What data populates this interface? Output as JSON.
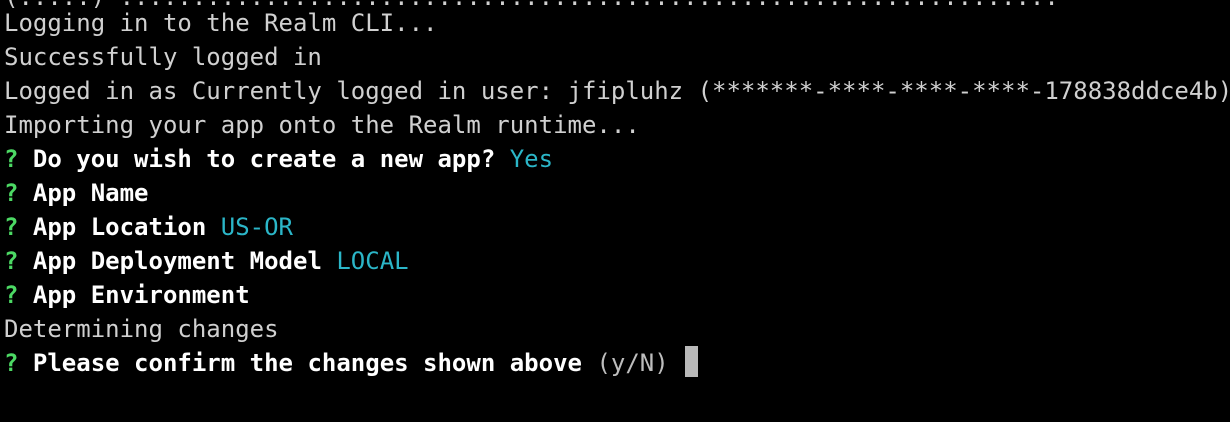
{
  "terminal": {
    "clipped_top_line": "(.....) .................................................................",
    "lines": [
      {
        "text": "Logging in to the Realm CLI..."
      },
      {
        "text": "Successfully logged in"
      },
      {
        "text": "Logged in as Currently logged in user: jfipluhz (*******-****-****-****-178838ddce4b)"
      },
      {
        "text": "Importing your app onto the Realm runtime..."
      }
    ],
    "questions": [
      {
        "mark": "?",
        "prompt": "Do you wish to create a new app?",
        "answer": "Yes"
      },
      {
        "mark": "?",
        "prompt": "App Name",
        "answer": ""
      },
      {
        "mark": "?",
        "prompt": "App Location",
        "answer": "US-OR"
      },
      {
        "mark": "?",
        "prompt": "App Deployment Model",
        "answer": "LOCAL"
      },
      {
        "mark": "?",
        "prompt": "App Environment",
        "answer": ""
      }
    ],
    "status_line": "Determining changes",
    "confirm": {
      "mark": "?",
      "prompt": "Please confirm the changes shown above",
      "hint": "(y/N)"
    },
    "colors": {
      "background": "#000000",
      "output_text": "#d0d0d0",
      "question_mark": "#4cd964",
      "prompt_text": "#ffffff",
      "answer_text": "#2bb6c8",
      "cursor": "#b9b9b9"
    }
  }
}
